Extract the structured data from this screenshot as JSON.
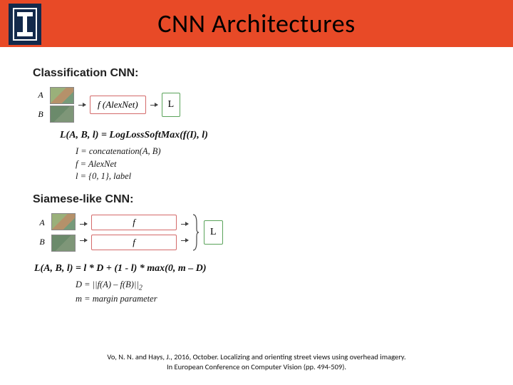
{
  "header": {
    "title": "CNN Architectures"
  },
  "sec1": {
    "title": "Classification CNN:",
    "labelA": "A",
    "labelB": "B",
    "block_f": "f (AlexNet)",
    "block_L": "L",
    "formula": "L(A, B, l) = LogLossSoftMax(f(I), l)",
    "sub1": "I = concatenation(A, B)",
    "sub2": "f = AlexNet",
    "sub3": "l = {0, 1}, label"
  },
  "sec2": {
    "title": "Siamese-like CNN:",
    "labelA": "A",
    "labelB": "B",
    "block_f": "f",
    "block_L": "L",
    "formula": "L(A, B, l) = l * D + (1 - l) * max(0, m – D)",
    "sub1_pre": "D = ||f(A) – f(B)||",
    "sub1_suf": "2",
    "sub2": "m = margin parameter"
  },
  "citation": {
    "line1": "Vo, N. N. and Hays, J., 2016, October. Localizing and orienting street views using overhead imagery.",
    "line2": "In European Conference on Computer Vision (pp. 494-509)."
  }
}
